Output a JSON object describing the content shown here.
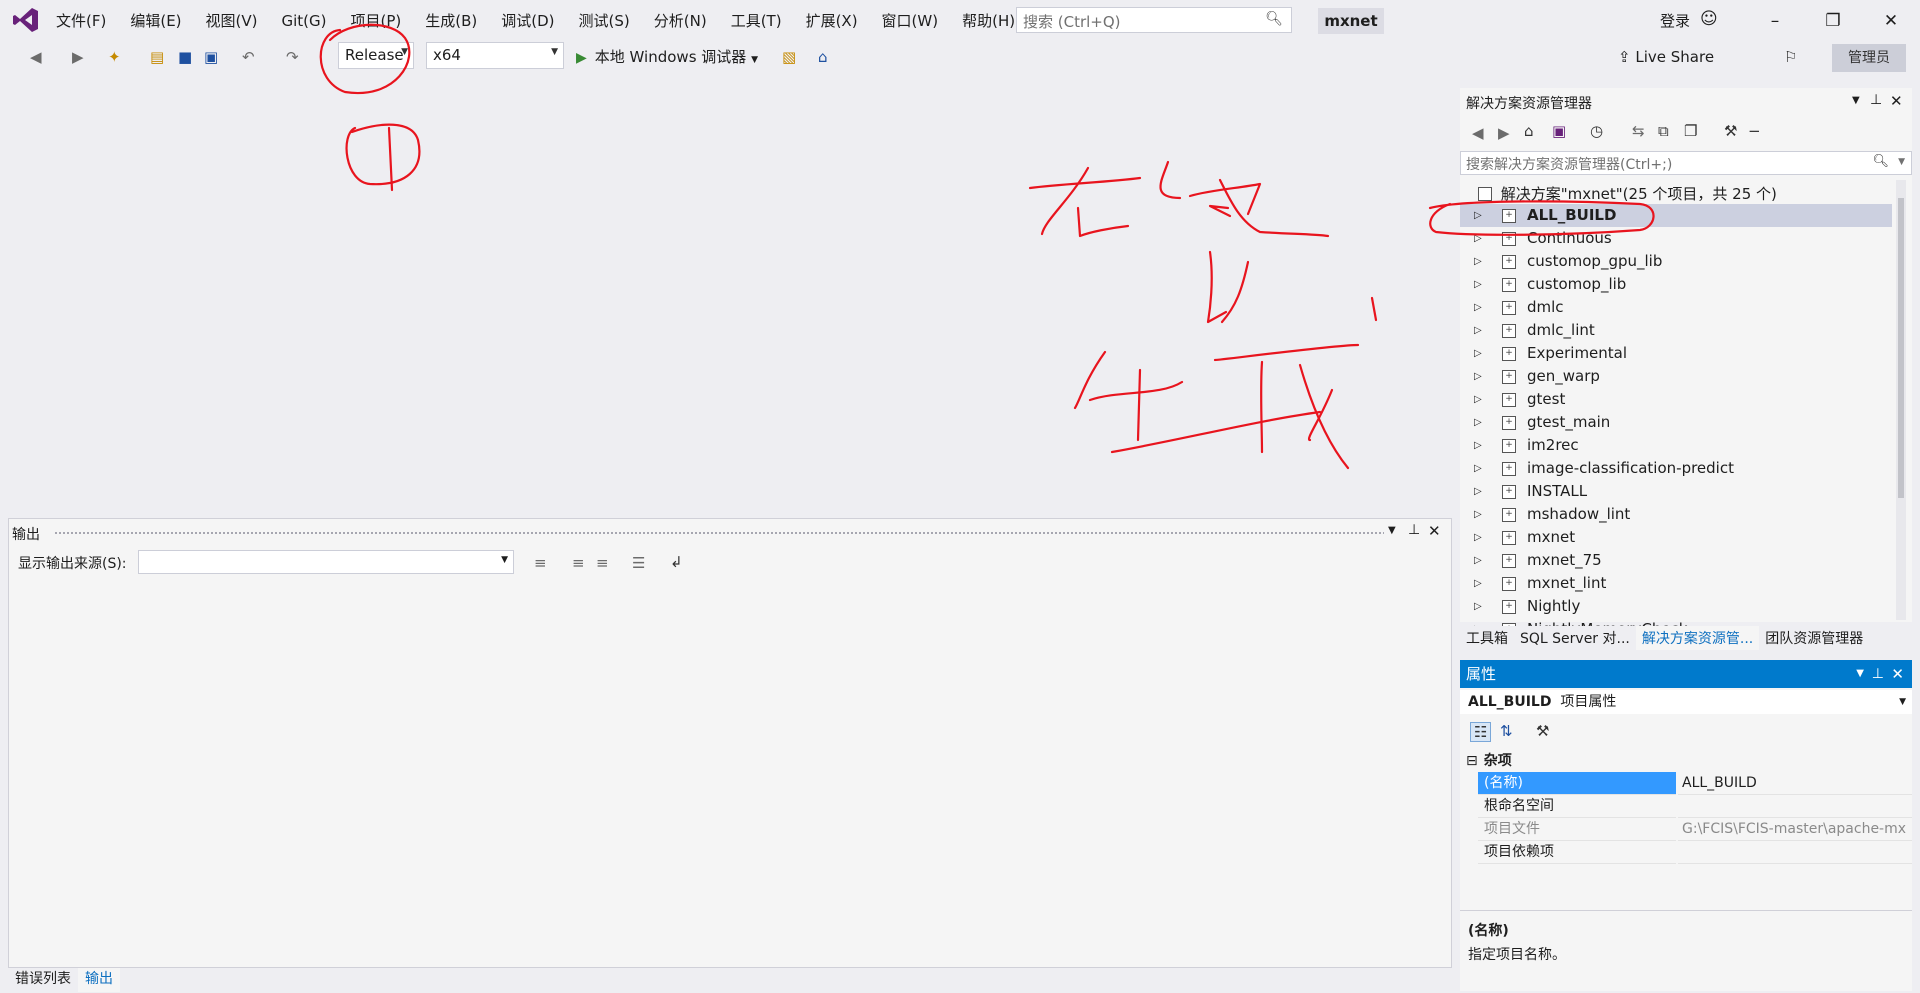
{
  "menubar": {
    "items": [
      "文件(F)",
      "编辑(E)",
      "视图(V)",
      "Git(G)",
      "项目(P)",
      "生成(B)",
      "调试(D)",
      "测试(S)",
      "分析(N)",
      "工具(T)",
      "扩展(X)",
      "窗口(W)",
      "帮助(H)"
    ],
    "search_placeholder": "搜索 (Ctrl+Q)",
    "solution_name": "mxnet",
    "login": "登录"
  },
  "toolbar": {
    "config": "Release",
    "platform": "x64",
    "run_label": "本地 Windows 调试器",
    "live_share": "Live Share",
    "admin": "管理员"
  },
  "output": {
    "title": "输出",
    "source_label": "显示输出来源(S):",
    "source_value": ""
  },
  "bottom_tabs": [
    "错误列表",
    "输出"
  ],
  "solution_explorer": {
    "title": "解决方案资源管理器",
    "search_placeholder": "搜索解决方案资源管理器(Ctrl+;)",
    "root": "解决方案\"mxnet\"(25 个项目，共 25 个)",
    "projects": [
      "ALL_BUILD",
      "Continuous",
      "customop_gpu_lib",
      "customop_lib",
      "dmlc",
      "dmlc_lint",
      "Experimental",
      "gen_warp",
      "gtest",
      "gtest_main",
      "im2rec",
      "image-classification-predict",
      "INSTALL",
      "mshadow_lint",
      "mxnet",
      "mxnet_75",
      "mxnet_lint",
      "Nightly",
      "NightlyMemoryCheck"
    ],
    "selected": "ALL_BUILD"
  },
  "panel_tabs": [
    "工具箱",
    "SQL Server 对...",
    "解决方案资源管...",
    "团队资源管理器"
  ],
  "properties": {
    "title": "属性",
    "object_name": "ALL_BUILD",
    "object_type": "项目属性",
    "category": "杂项",
    "rows": [
      {
        "key": "(名称)",
        "value": "ALL_BUILD"
      },
      {
        "key": "根命名空间",
        "value": ""
      },
      {
        "key": "项目文件",
        "value": "G:\\FCIS\\FCIS-master\\apache-mx"
      },
      {
        "key": "项目依赖项",
        "value": ""
      }
    ],
    "desc_title": "(名称)",
    "desc_text": "指定项目名称。"
  },
  "annotation_text": "右键 → 生成",
  "colors": {
    "accent": "#007acc",
    "annotation": "#e8141e",
    "selection": "#ccd0e0"
  }
}
